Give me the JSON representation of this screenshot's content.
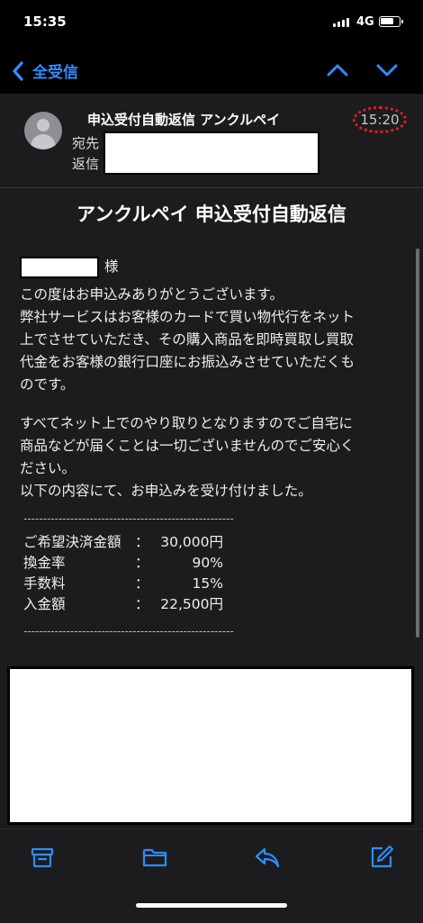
{
  "status_bar": {
    "time": "15:35",
    "network": "4G",
    "battery_level": 0.8
  },
  "nav": {
    "back_label": "全受信",
    "accent_color": "#2f8dff"
  },
  "mail": {
    "sender": "申込受付自動返信 アンクルペイ",
    "time": "15:20",
    "to_label": "宛先",
    "reply_label": "返信",
    "subject": "アンクルペイ 申込受付自動返信",
    "salutation": "様",
    "body1": [
      "この度はお申込みありがとうございます。",
      "弊社サービスはお客様のカードで買い物代行をネット",
      "上でさせていただき、その購入商品を即時買取し買取",
      "代金をお客様の銀行口座にお振込みさせていただくも",
      "のです。"
    ],
    "body2": [
      "すべてネット上でのやり取りとなりますのでご自宅に",
      "商品などが届くことは一切ございませんのでご安心く",
      "ださい。",
      "以下の内容にて、お申込みを受け付けました。"
    ],
    "separator": "------------------------------------------------------",
    "details": [
      {
        "label": "ご希望決済金額",
        "colon": "：",
        "value": "30,000円"
      },
      {
        "label": "換金率",
        "colon": "：",
        "value": "90%"
      },
      {
        "label": "手数料",
        "colon": "：",
        "value": "15%"
      },
      {
        "label": "入金額",
        "colon": "：",
        "value": "22,500円"
      }
    ]
  },
  "toolbar": {
    "icons": [
      "archive-icon",
      "folder-icon",
      "reply-icon",
      "compose-icon"
    ]
  }
}
